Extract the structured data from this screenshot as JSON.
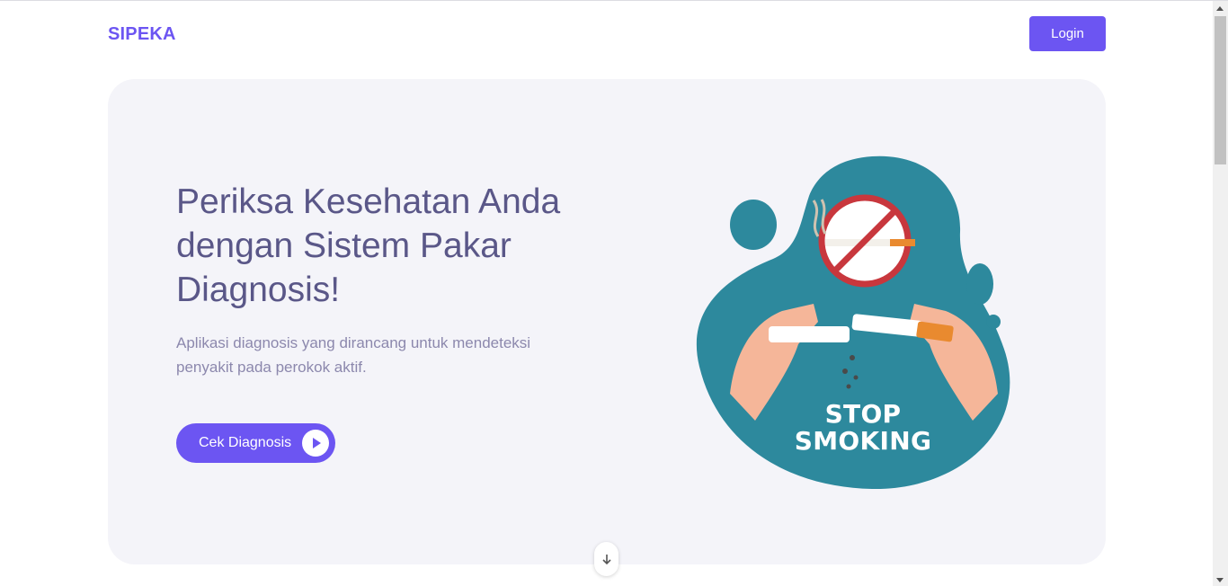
{
  "nav": {
    "brand": "SIPEKA",
    "login_label": "Login"
  },
  "hero": {
    "headline": "Periksa Kesehatan Anda dengan Sistem Pakar Diagnosis!",
    "subtext": "Aplikasi diagnosis yang dirancang untuk mendeteksi penyakit pada perokok aktif.",
    "cta_label": "Cek Diagnosis",
    "cta_icon": "play-icon",
    "illustration": {
      "line1": "STOP",
      "line2": "SMOKING"
    }
  },
  "scroll_down_icon": "arrow-down-icon",
  "colors": {
    "accent": "#6c55f2",
    "hero_bg": "#f4f4f9",
    "headline": "#5a5788",
    "blob": "#2d899d"
  }
}
